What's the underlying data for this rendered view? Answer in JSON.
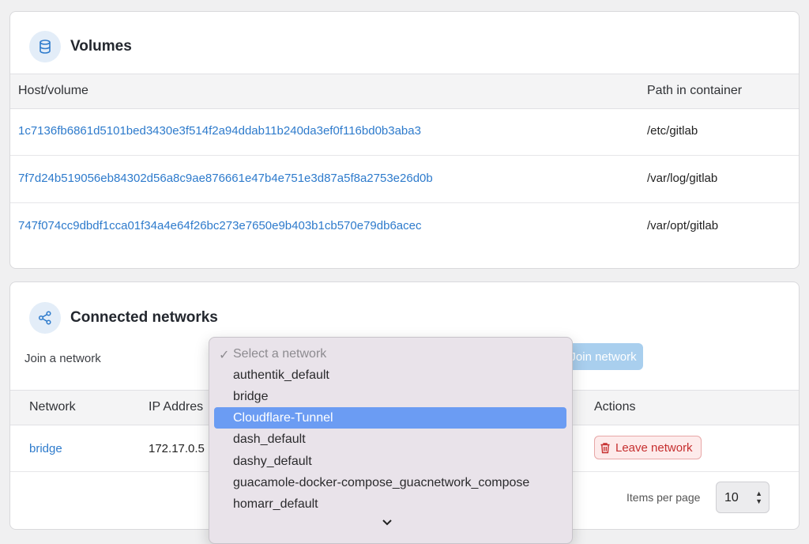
{
  "volumes": {
    "title": "Volumes",
    "icon": "database-icon",
    "columns": [
      "Host/volume",
      "Path in container"
    ],
    "rows": [
      {
        "host": "1c7136fb6861d5101bed3430e3f514f2a94ddab11b240da3ef0f116bd0b3aba3",
        "path": "/etc/gitlab"
      },
      {
        "host": "7f7d24b519056eb84302d56a8c9ae876661e47b4e751e3d87a5f8a2753e26d0b",
        "path": "/var/log/gitlab"
      },
      {
        "host": "747f074cc9dbdf1cca01f34a4e64f26bc273e7650e9b403b1cb570e79db6acec",
        "path": "/var/opt/gitlab"
      }
    ]
  },
  "networks": {
    "title": "Connected networks",
    "icon": "share-icon",
    "join_label": "Join a network",
    "join_button": "Join network",
    "columns": [
      "Network",
      "IP Addres",
      "Actions"
    ],
    "rows": [
      {
        "network": "bridge",
        "ip": "172.17.0.5",
        "action": "Leave network"
      }
    ],
    "items_per_page_label": "Items per page",
    "items_per_page_value": "10"
  },
  "dropdown": {
    "placeholder": "Select a network",
    "check": "✓",
    "options": [
      "authentik_default",
      "bridge",
      "Cloudflare-Tunnel",
      "dash_default",
      "dashy_default",
      "guacamole-docker-compose_guacnetwork_compose",
      "homarr_default"
    ],
    "highlighted": "Cloudflare-Tunnel",
    "more_indicator": "⌄"
  },
  "colors": {
    "link": "#2e7bcc",
    "accent_light": "#a9cfee",
    "danger": "#c62f2f",
    "highlight": "#6b9cf3"
  }
}
